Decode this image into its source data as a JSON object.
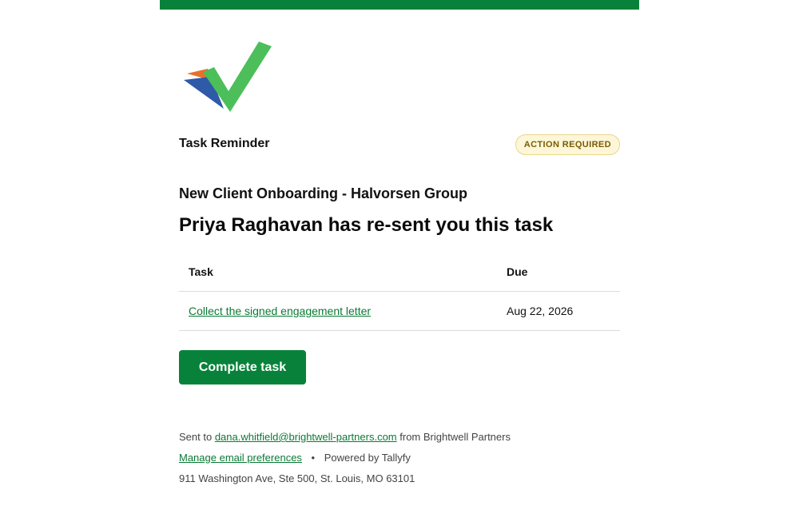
{
  "email": {
    "header_label": "Task Reminder",
    "badge": "ACTION REQUIRED",
    "process_title": "New Client Onboarding - Halvorsen Group",
    "headline": "Priya Raghavan has re-sent you this task",
    "table": {
      "columns": [
        "Task",
        "Due"
      ],
      "rows": [
        {
          "task": "Collect the signed engagement letter",
          "due": "Aug 22, 2026"
        }
      ]
    },
    "cta_label": "Complete task",
    "footer": {
      "sent_to_prefix": "Sent to",
      "recipient_email": "dana.whitfield@brightwell-partners.com",
      "sent_from": "from Brightwell Partners",
      "manage_link": "Manage email preferences",
      "separator": "•",
      "powered_by": "Powered by Tallyfy",
      "address": "911 Washington Ave, Ste 500, St. Louis, MO 63101"
    }
  },
  "colors": {
    "brand_green": "#08823a",
    "link_green": "#0a7a34",
    "logo_green": "#4cbf5a",
    "logo_orange": "#e8702a",
    "logo_blue": "#2f5aa8",
    "badge_bg": "#fdf6d8",
    "badge_text": "#7a5c00"
  },
  "icons": {
    "logo": "checkmark-logo-icon"
  }
}
